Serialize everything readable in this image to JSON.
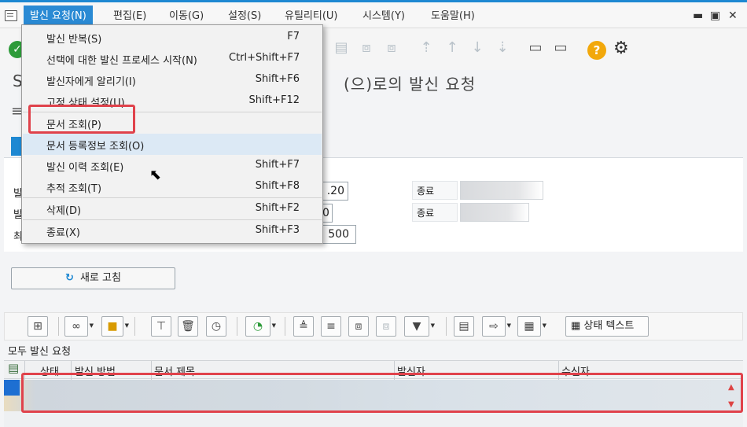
{
  "menubar": {
    "items": [
      "발신 요청(N)",
      "편집(E)",
      "이동(G)",
      "설정(S)",
      "유틸리티(U)",
      "시스템(Y)",
      "도움말(H)"
    ],
    "active_index": 0
  },
  "title": {
    "left_char": "S",
    "text": "(으)로의 발신 요청"
  },
  "dropdown": {
    "items": [
      {
        "label": "발신 반복(S)",
        "shortcut": "F7"
      },
      {
        "label": "선택에 대한 발신 프로세스 시작(N)",
        "shortcut": "Ctrl+Shift+F7"
      },
      {
        "label": "발신자에게 알리기(I)",
        "shortcut": "Shift+F6"
      },
      {
        "label": "고정 상태 설정(U)",
        "shortcut": "Shift+F12"
      },
      {
        "label": "문서 조회(P)",
        "shortcut": ""
      },
      {
        "label": "문서 등록정보 조회(O)",
        "shortcut": ""
      },
      {
        "label": "발신 이력 조회(E)",
        "shortcut": "Shift+F7"
      },
      {
        "label": "추적 조회(T)",
        "shortcut": "Shift+F8"
      },
      {
        "label": "삭제(D)",
        "shortcut": "Shift+F2"
      },
      {
        "label": "종료(X)",
        "shortcut": "Shift+F3"
      }
    ]
  },
  "form": {
    "cut_labels": [
      "발",
      "발",
      "최"
    ],
    "field_values": [
      ".20",
      "0",
      "500"
    ],
    "end_label_1": "종료",
    "end_label_2": "종료"
  },
  "refresh_button": "새로 고침",
  "grid": {
    "status_text_button": "상태 텍스트",
    "title": "모두 발신 요청",
    "columns": [
      "상태",
      "발신 방법",
      "문서 제목",
      "발신자",
      "수신자"
    ]
  },
  "colors": {
    "accent": "#1e88d2",
    "highlight": "#e0424b",
    "ok_green": "#2e9b3a",
    "help_orange": "#f2a80b"
  }
}
